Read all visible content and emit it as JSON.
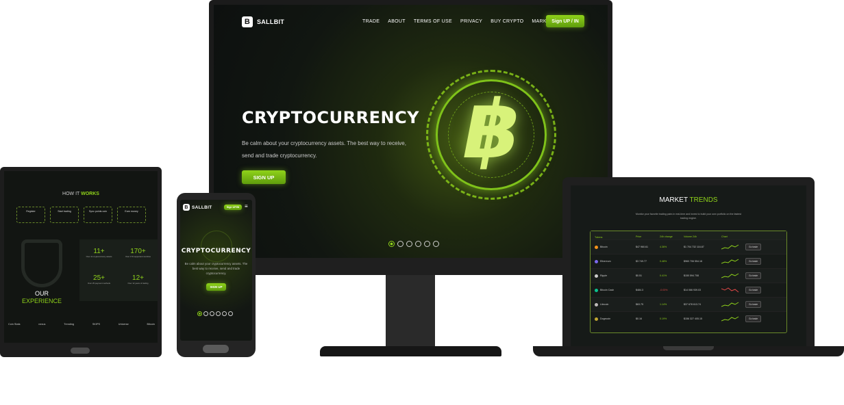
{
  "brand": "SALLBIT",
  "desktop": {
    "nav": [
      "TRADE",
      "ABOUT",
      "TERMS OF USE",
      "PRIVACY",
      "BUY CRYPTO",
      "MARKETS"
    ],
    "signup_label": "Sign UP / IN",
    "hero_title": "CRYPTOCURRENCY",
    "hero_text_1": "Be calm about your cryptocurrency assets. The best way to receive,",
    "hero_text_2": "send and trade cryptocurrency.",
    "cta_label": "SIGN UP",
    "coin_symbol": "฿"
  },
  "tablet": {
    "how_title_1": "HOW IT ",
    "how_title_2": "WORKS",
    "steps": [
      "Register",
      "Start trading",
      "Sync points coin",
      "Earn money"
    ],
    "stats": [
      {
        "value": "11+",
        "label": "Over 11 cryptocurrency assets"
      },
      {
        "value": "170+",
        "label": "Over 170 supported countries"
      },
      {
        "value": "25+",
        "label": "Over 25 payment methods"
      },
      {
        "value": "12+",
        "label": "Over 12 years of trading"
      }
    ],
    "experience_1": "OUR",
    "experience_2": "EXPERIENCE",
    "partners": [
      "Coin Stats",
      "nexus",
      "Trending",
      "SKIPS",
      "Universe",
      "Bitcoin"
    ]
  },
  "phone": {
    "signup_label": "Sign UP/IN",
    "hero_title": "CRYPTOCURRENCY",
    "hero_text": "Be calm about your cryptocurrency assets. The best way to receive, send and trade cryptocurrency.",
    "cta_label": "SIGN UP"
  },
  "laptop": {
    "title_1": "MARKET ",
    "title_2": "TRENDS",
    "subtitle": "Monitor your favorite trading pairs in real-time and invest to build your own portfolio on the fastest trading engine.",
    "columns": [
      "Tokens",
      "Price",
      "24h change",
      "Volume 24h",
      "Chart",
      ""
    ],
    "rows": [
      {
        "name": "Bitcoin",
        "price": "$47 960.61",
        "change": "4.36%",
        "volume": "$1 704 732 116.87",
        "action": "Go trade",
        "color": "#f7931a",
        "up": true
      },
      {
        "name": "Ethereum",
        "price": "$3 749.77",
        "change": "0.48%",
        "volume": "$960 706 554.18",
        "action": "Go trade",
        "color": "#7b68ee",
        "up": true
      },
      {
        "name": "Ripple",
        "price": "$0.51",
        "change": "0.41%",
        "volume": "$150 594 708",
        "action": "Go trade",
        "color": "#cccccc",
        "up": true
      },
      {
        "name": "Bitcoin Cash",
        "price": "$484.3",
        "change": "-0.03%",
        "volume": "$14 066 939.03",
        "action": "Go trade",
        "color": "#0ac18e",
        "up": false
      },
      {
        "name": "Litecoin",
        "price": "$63.75",
        "change": "1.14%",
        "volume": "$37 678 613.74",
        "action": "Go trade",
        "color": "#bfbbbb",
        "up": true
      },
      {
        "name": "Dogecoin",
        "price": "$0.16",
        "change": "0.19%",
        "volume": "$156 327 405.15",
        "action": "Go trade",
        "color": "#c2a633",
        "up": true
      }
    ]
  },
  "colors": {
    "accent": "#8fd21a",
    "down": "#e04848"
  }
}
